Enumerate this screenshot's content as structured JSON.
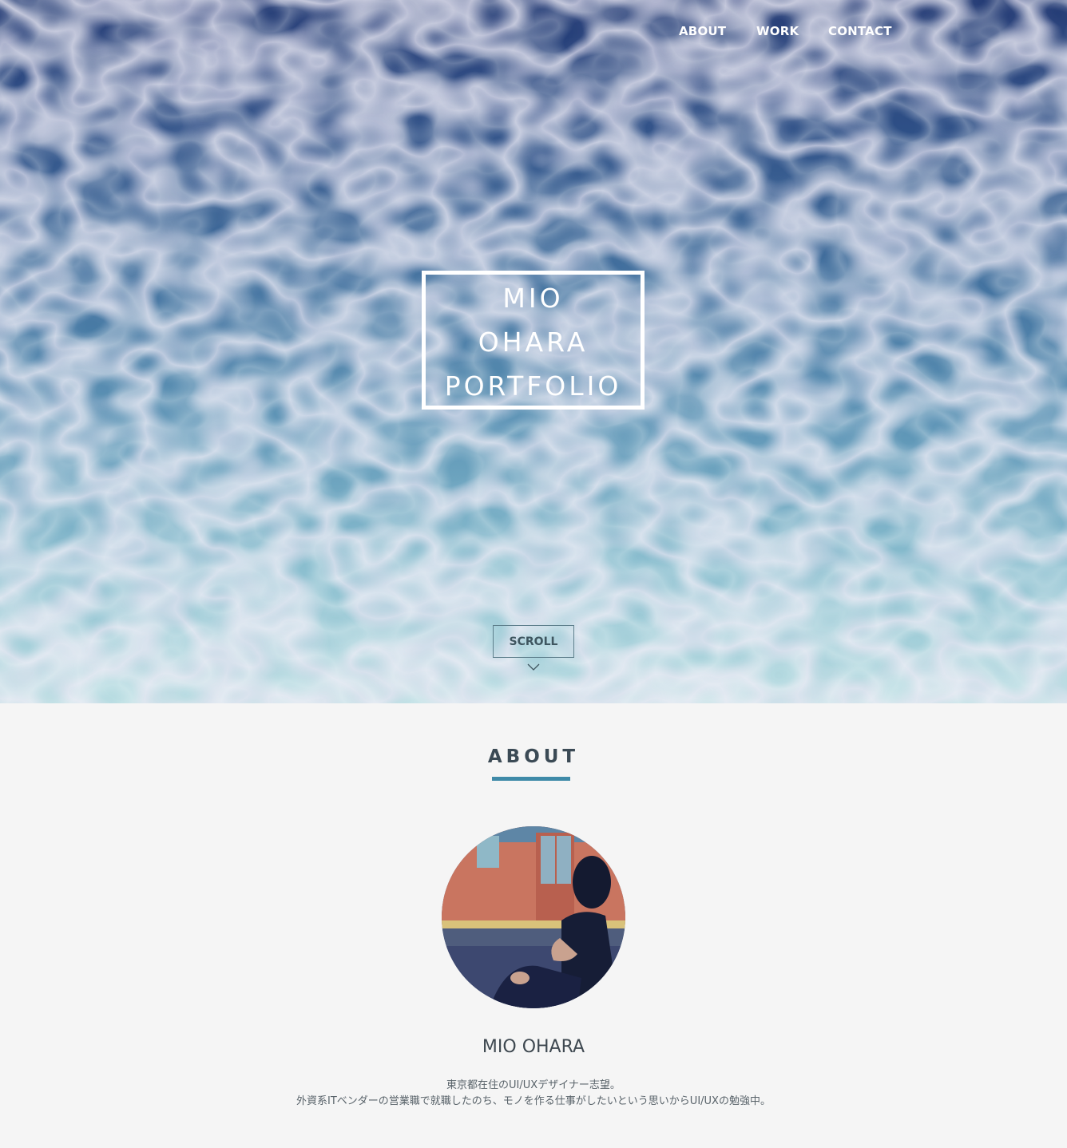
{
  "nav": {
    "items": [
      {
        "label": "ABOUT"
      },
      {
        "label": "WORK"
      },
      {
        "label": "CONTACT"
      }
    ]
  },
  "hero": {
    "title_lines": [
      "MIO",
      "OHARA",
      "PORTFOLIO"
    ],
    "scroll_label": "SCROLL"
  },
  "about": {
    "heading": "ABOUT",
    "name": "MIO OHARA",
    "bio_lines": [
      "東京都在住のUI/UXデザイナー志望。",
      "外資系ITベンダーの営業職で就職したのち、モノを作る仕事がしたいという思いからUI/UXの勉強中。"
    ]
  },
  "colors": {
    "accent": "#3f8aa8",
    "heading_text": "#3b4a55",
    "water_top": "#233a74",
    "water_bottom": "#b9dde2",
    "background": "#f5f5f5"
  },
  "icons": {
    "scroll": "chevron-down-icon"
  }
}
